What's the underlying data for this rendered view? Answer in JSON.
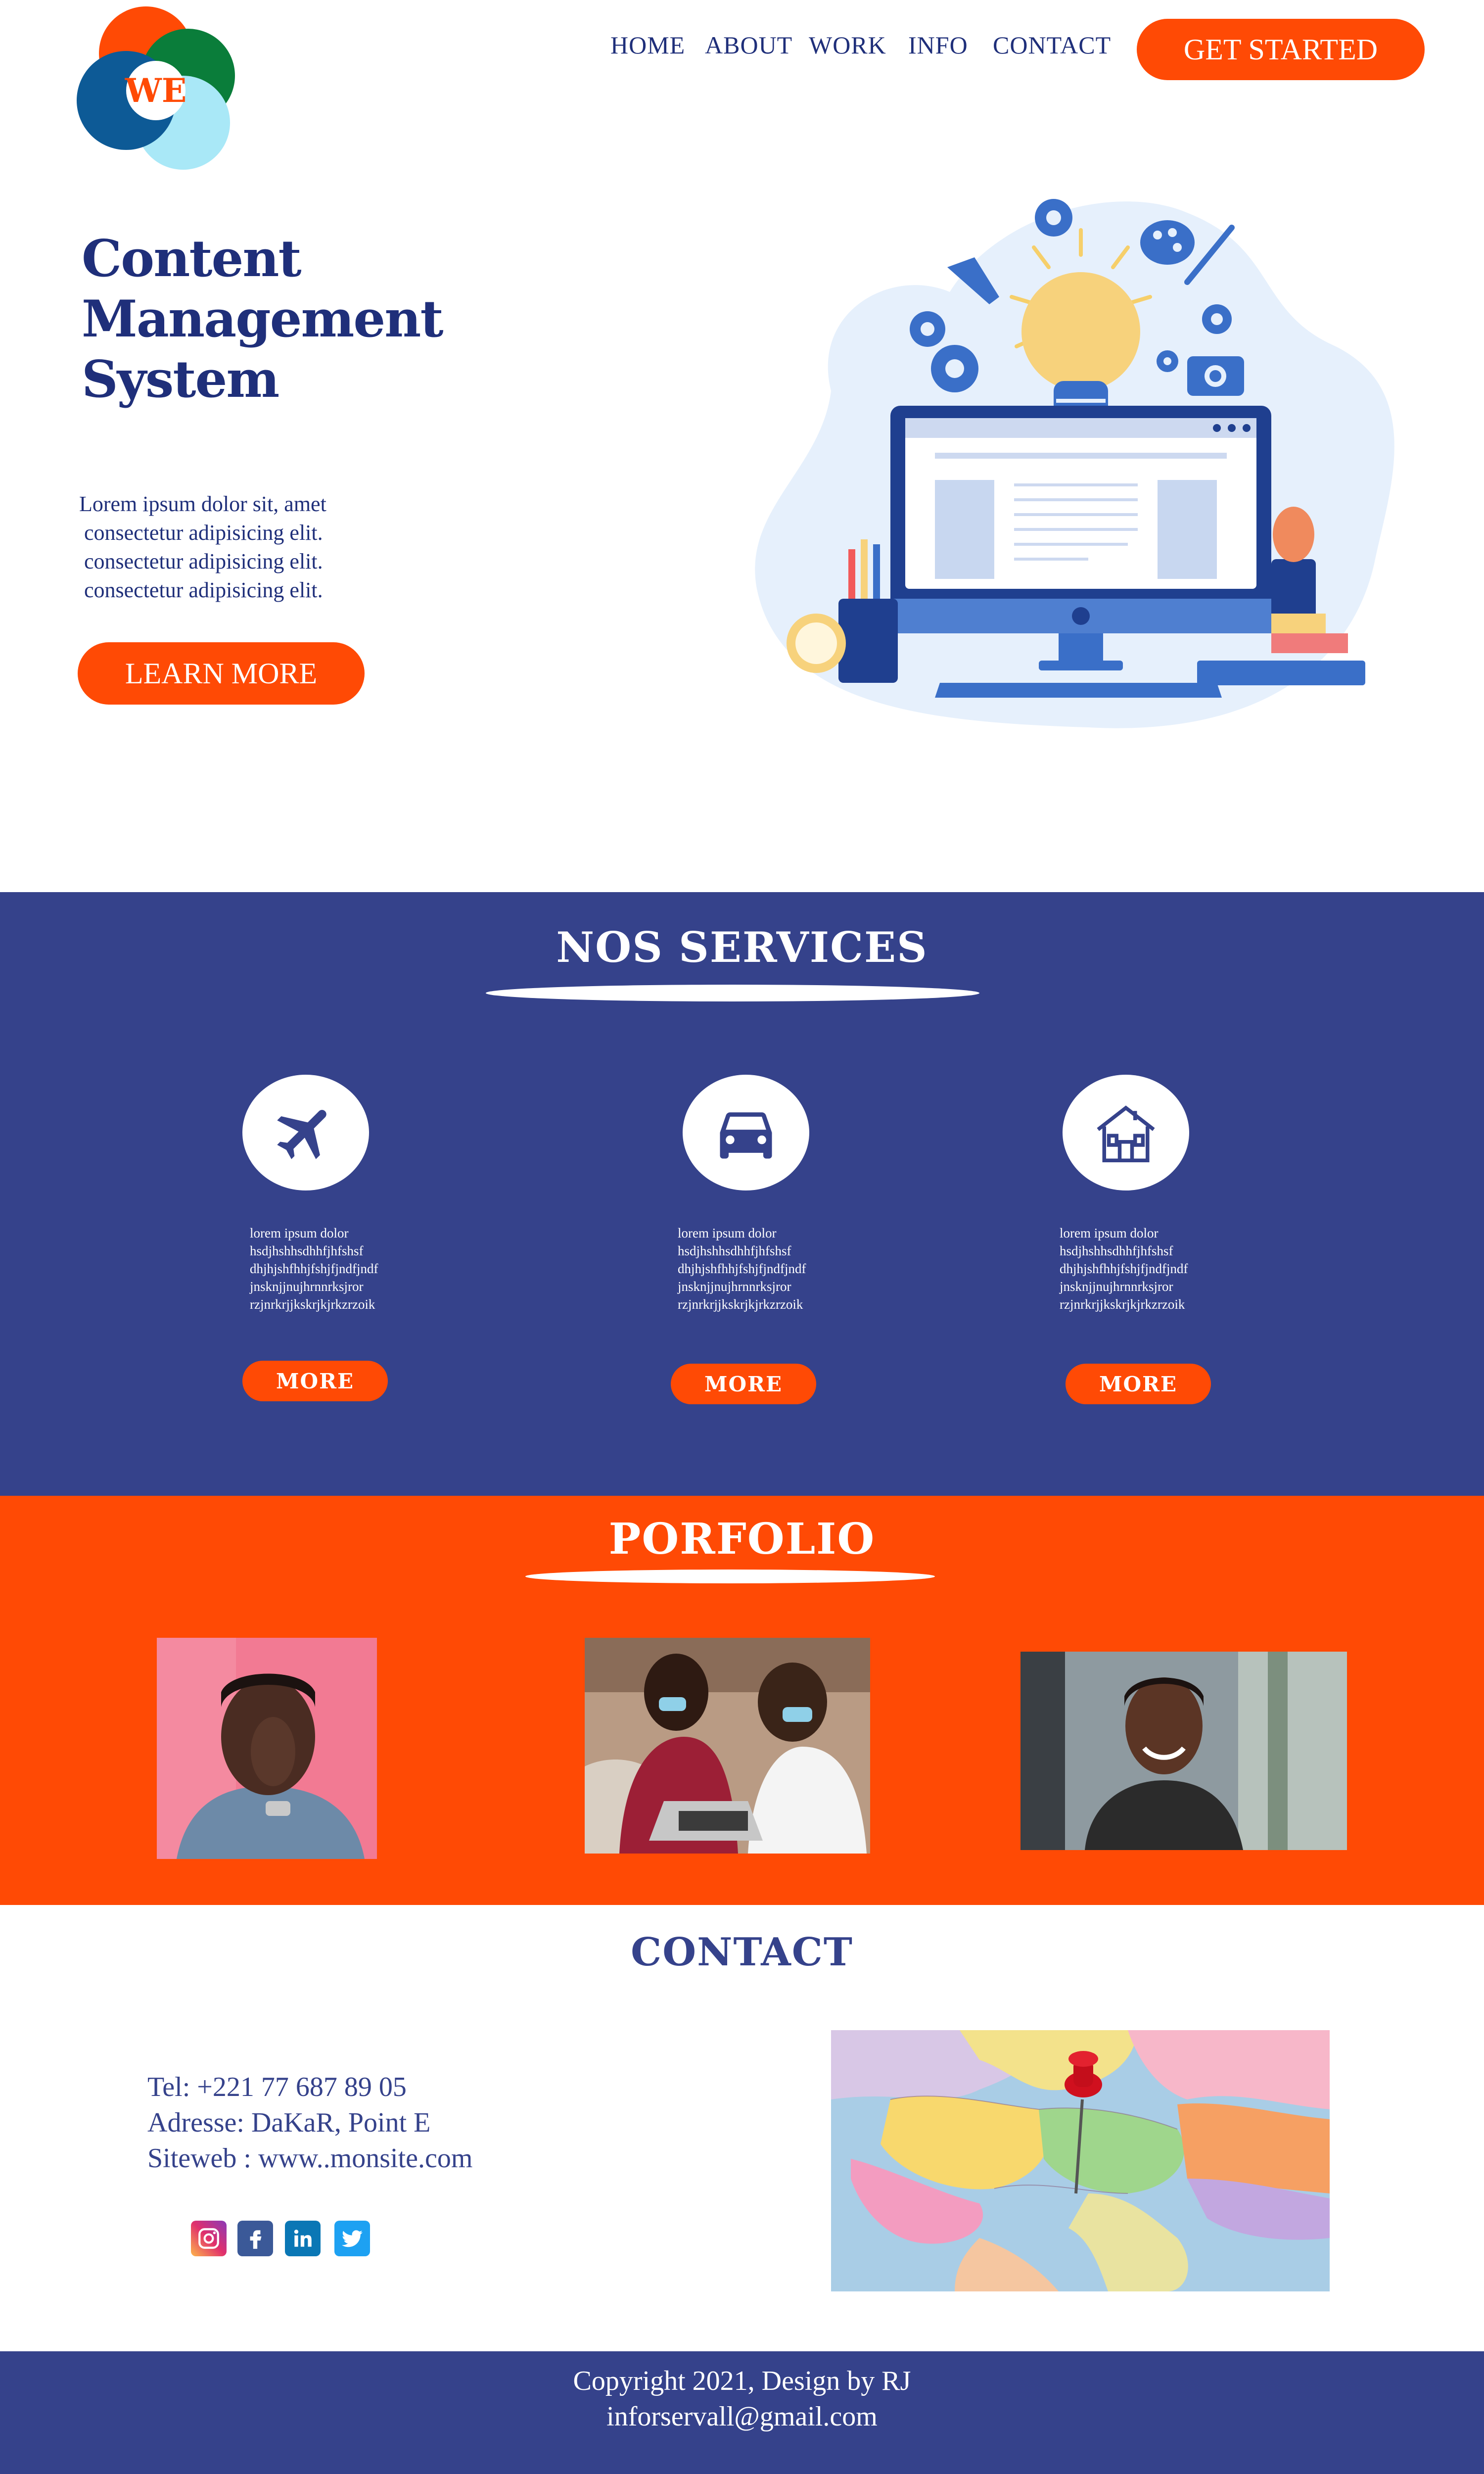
{
  "brand": {
    "logo_text": "WE"
  },
  "nav": {
    "items": [
      {
        "label": "HOME"
      },
      {
        "label": "ABOUT"
      },
      {
        "label": "WORK"
      },
      {
        "label": "INFO"
      },
      {
        "label": "CONTACT"
      }
    ],
    "cta_label": "GET STARTED"
  },
  "hero": {
    "title_lines": [
      "Content",
      "Management",
      "System"
    ],
    "text_lines": [
      "Lorem ipsum dolor sit, amet",
      "consectetur adipisicing elit.",
      "consectetur adipisicing elit.",
      "consectetur adipisicing elit."
    ],
    "button_label": "LEARN MORE"
  },
  "services": {
    "title": "NOS SERVICES",
    "items": [
      {
        "icon": "airplane-icon",
        "text_lines": [
          "lorem ipsum dolor",
          "hsdjhshhsdhhfjhfshsf",
          "dhjhjshfhhjfshjfjndfjndf",
          "jnsknjjnujhrnnrksjror",
          "rzjnrkrjjkskrjkjrkzrzoik"
        ],
        "button_label": "MORE"
      },
      {
        "icon": "car-icon",
        "text_lines": [
          "lorem ipsum dolor",
          "hsdjhshhsdhhfjhfshsf",
          "dhjhjshfhhjfshjfjndfjndf",
          "jnsknjjnujhrnnrksjror",
          "rzjnrkrjjkskrjkjrkzrzoik"
        ],
        "button_label": "MORE"
      },
      {
        "icon": "house-icon",
        "text_lines": [
          "lorem ipsum dolor",
          "hsdjhshhsdhhfjhfshsf",
          "dhjhjshfhhjfshjfjndfjndf",
          "jnsknjjnujhrnnrksjror",
          "rzjnrkrjjkskrjkjrkzrzoik"
        ],
        "button_label": "MORE"
      }
    ]
  },
  "portfolio": {
    "title": "PORFOLIO"
  },
  "contact": {
    "title": "CONTACT",
    "tel": "Tel: +221 77 687 89 05",
    "address": "Adresse: DaKaR, Point E",
    "website": "Siteweb : www..monsite.com",
    "socials": [
      "instagram-icon",
      "facebook-icon",
      "linkedin-icon",
      "twitter-icon"
    ]
  },
  "footer": {
    "copyright": "Copyright 2021, Design by RJ",
    "email": "inforservall@gmail.com"
  },
  "colors": {
    "accent": "#ff4a05",
    "navy": "#35428b",
    "text": "#1f2f7a"
  }
}
